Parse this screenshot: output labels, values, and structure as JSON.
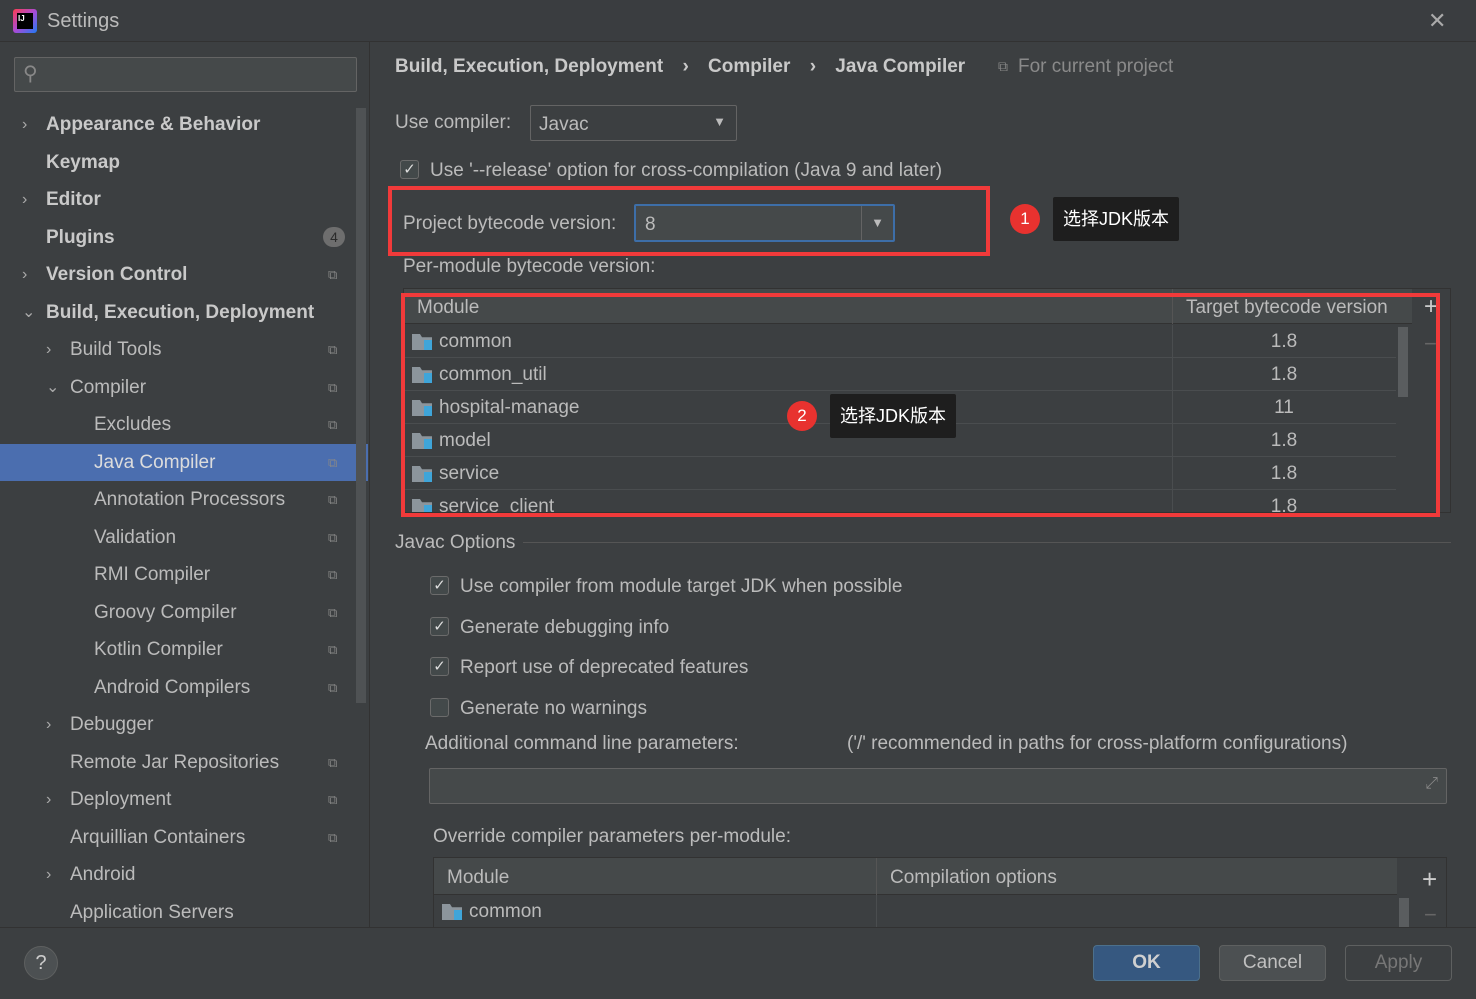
{
  "window": {
    "title": "Settings",
    "close": "✕"
  },
  "search": {
    "placeholder": ""
  },
  "sidebar": {
    "items": [
      {
        "label": "Appearance & Behavior",
        "level": 0,
        "arrow": "›",
        "bold": true
      },
      {
        "label": "Keymap",
        "level": 0,
        "bold": true
      },
      {
        "label": "Editor",
        "level": 0,
        "arrow": "›",
        "bold": true
      },
      {
        "label": "Plugins",
        "level": 0,
        "bold": true,
        "badge": "4"
      },
      {
        "label": "Version Control",
        "level": 0,
        "arrow": "›",
        "bold": true,
        "cfg": true
      },
      {
        "label": "Build, Execution, Deployment",
        "level": 0,
        "arrow": "⌄",
        "bold": true
      },
      {
        "label": "Build Tools",
        "level": 1,
        "arrow": "›",
        "cfg": true
      },
      {
        "label": "Compiler",
        "level": 1,
        "arrow": "⌄",
        "cfg": true
      },
      {
        "label": "Excludes",
        "level": 2,
        "cfg": true
      },
      {
        "label": "Java Compiler",
        "level": 2,
        "cfg": true,
        "selected": true
      },
      {
        "label": "Annotation Processors",
        "level": 2,
        "cfg": true
      },
      {
        "label": "Validation",
        "level": 2,
        "cfg": true
      },
      {
        "label": "RMI Compiler",
        "level": 2,
        "cfg": true
      },
      {
        "label": "Groovy Compiler",
        "level": 2,
        "cfg": true
      },
      {
        "label": "Kotlin Compiler",
        "level": 2,
        "cfg": true
      },
      {
        "label": "Android Compilers",
        "level": 2,
        "cfg": true
      },
      {
        "label": "Debugger",
        "level": 1,
        "arrow": "›"
      },
      {
        "label": "Remote Jar Repositories",
        "level": 1,
        "cfg": true
      },
      {
        "label": "Deployment",
        "level": 1,
        "arrow": "›",
        "cfg": true
      },
      {
        "label": "Arquillian Containers",
        "level": 1,
        "cfg": true
      },
      {
        "label": "Android",
        "level": 1,
        "arrow": "›"
      },
      {
        "label": "Application Servers",
        "level": 1
      }
    ]
  },
  "breadcrumb": {
    "items": [
      "Build, Execution, Deployment",
      "Compiler",
      "Java Compiler"
    ],
    "sep": "›",
    "scope": "For current project"
  },
  "compiler": {
    "label": "Use compiler:",
    "value": "Javac"
  },
  "release_option": {
    "label": "Use '--release' option for cross-compilation (Java 9 and later)",
    "checked": true
  },
  "bytecode": {
    "label": "Project bytecode version:",
    "value": "8"
  },
  "per_module": {
    "label": "Per-module bytecode version:",
    "headers": [
      "Module",
      "Target bytecode version"
    ],
    "rows": [
      [
        "common",
        "1.8"
      ],
      [
        "common_util",
        "1.8"
      ],
      [
        "hospital-manage",
        "11"
      ],
      [
        "model",
        "1.8"
      ],
      [
        "service",
        "1.8"
      ],
      [
        "service_client",
        "1.8"
      ]
    ]
  },
  "annotations": [
    {
      "num": "1",
      "text": "选择JDK版本"
    },
    {
      "num": "2",
      "text": "选择JDK版本"
    }
  ],
  "javac": {
    "title": "Javac Options",
    "options": [
      {
        "label": "Use compiler from module target JDK when possible",
        "checked": true
      },
      {
        "label": "Generate debugging info",
        "checked": true
      },
      {
        "label": "Report use of deprecated features",
        "checked": true
      },
      {
        "label": "Generate no warnings",
        "checked": false
      }
    ],
    "params_label": "Additional command line parameters:",
    "params_hint": "('/' recommended in paths for cross-platform configurations)",
    "params_value": ""
  },
  "override": {
    "label": "Override compiler parameters per-module:",
    "headers": [
      "Module",
      "Compilation options"
    ],
    "rows": [
      [
        "common",
        ""
      ]
    ]
  },
  "buttons": {
    "help": "?",
    "ok": "OK",
    "cancel": "Cancel",
    "apply": "Apply",
    "add": "+",
    "remove": "−"
  },
  "colors": {
    "selection": "#4b6eaf",
    "annotation": "#f13a3a",
    "ok": "#365880"
  }
}
